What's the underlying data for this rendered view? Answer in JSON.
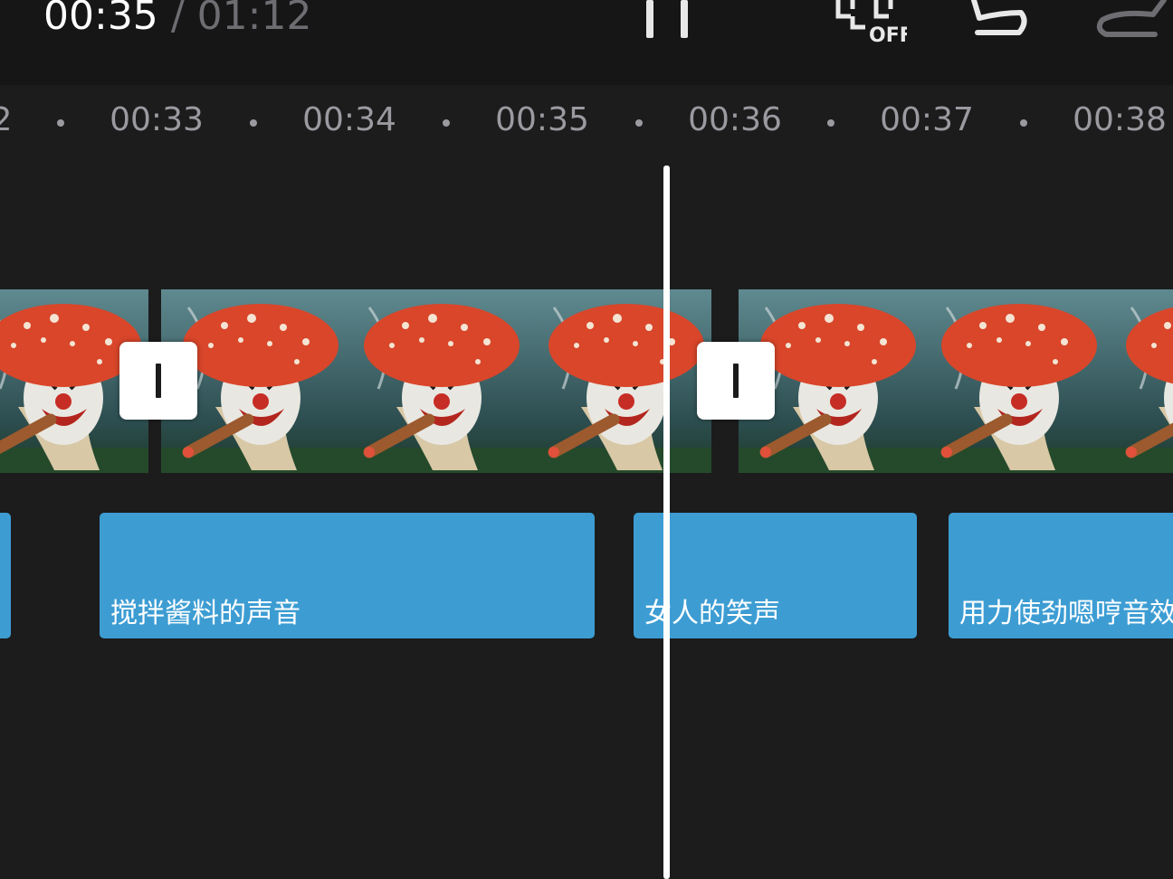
{
  "header": {
    "current_time": "00:35",
    "separator": "/",
    "total_time": "01:12",
    "snap_badge": "OFF"
  },
  "icons": {
    "pause": "pause-icon",
    "snap": "snap-off-icon",
    "undo": "undo-icon",
    "redo": "redo-icon"
  },
  "ruler": {
    "labels": [
      "2",
      "00:33",
      "00:34",
      "00:35",
      "00:36",
      "00:37",
      "00:38"
    ]
  },
  "audio_clips": [
    {
      "label": "",
      "name": "sound-clip-prev"
    },
    {
      "label": "搅拌酱料的声音",
      "name": "sound-clip-stirring-sauce"
    },
    {
      "label": "女人的笑声",
      "name": "sound-clip-woman-laughing"
    },
    {
      "label": "用力使劲嗯哼音效",
      "name": "sound-clip-straining-grunt"
    }
  ],
  "colors": {
    "background": "#1c1c1d",
    "audio_clip": "#3d9dd3",
    "playhead": "#ffffff",
    "mushroom_cap": "#d9462a"
  }
}
